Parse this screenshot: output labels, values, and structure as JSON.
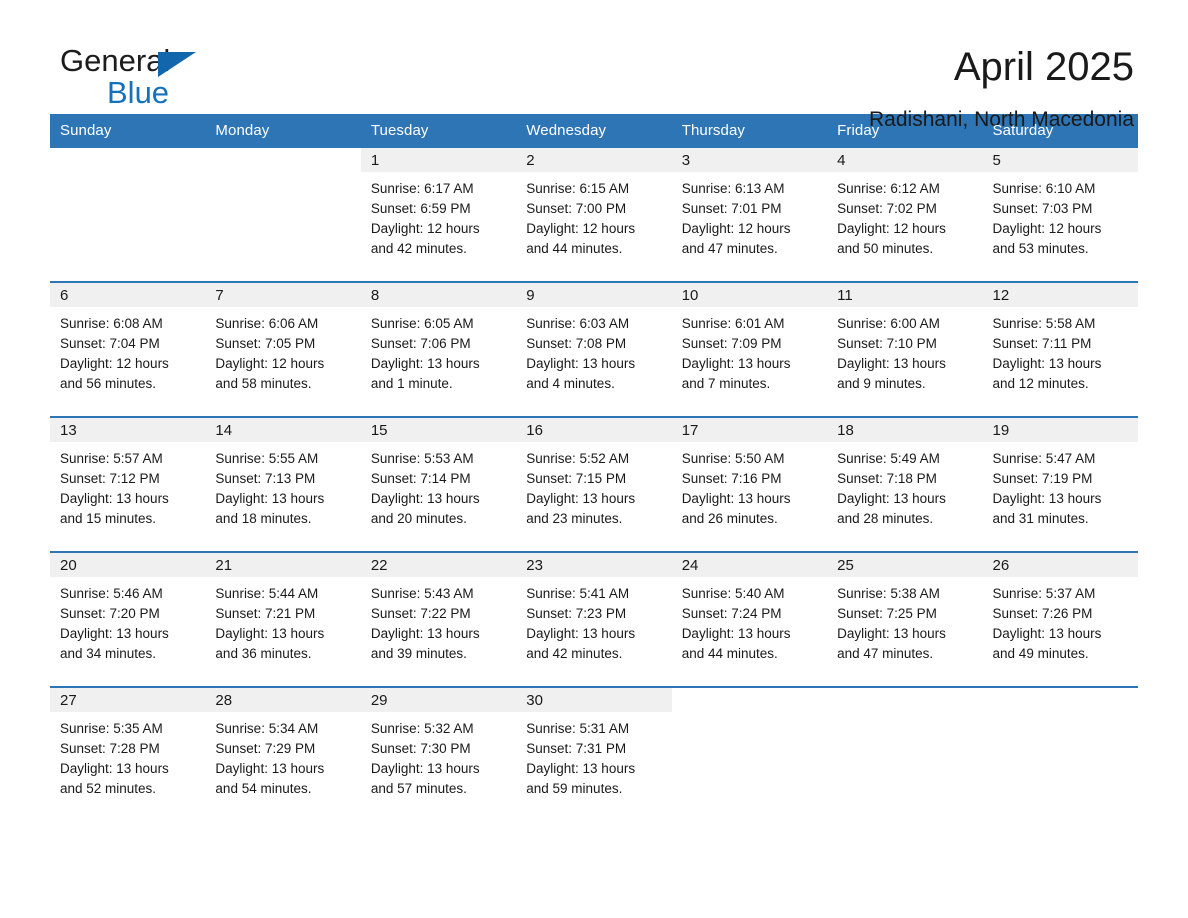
{
  "brand": {
    "name_part1": "General",
    "name_part2": "Blue",
    "triangle_color": "#1266ab",
    "blue_color": "#1372bb"
  },
  "header": {
    "title": "April 2025",
    "subtitle": "Radishani, North Macedonia"
  },
  "theme": {
    "header_blue": "#2e75b6",
    "daynum_band": "#f0f0f0",
    "text": "#1a1a1a"
  },
  "calendar": {
    "weekday_headers": [
      "Sunday",
      "Monday",
      "Tuesday",
      "Wednesday",
      "Thursday",
      "Friday",
      "Saturday"
    ],
    "weeks": [
      [
        {
          "day": "",
          "blank": true
        },
        {
          "day": "",
          "blank": true
        },
        {
          "day": "1",
          "sunrise": "Sunrise: 6:17 AM",
          "sunset": "Sunset: 6:59 PM",
          "daylight1": "Daylight: 12 hours",
          "daylight2": "and 42 minutes."
        },
        {
          "day": "2",
          "sunrise": "Sunrise: 6:15 AM",
          "sunset": "Sunset: 7:00 PM",
          "daylight1": "Daylight: 12 hours",
          "daylight2": "and 44 minutes."
        },
        {
          "day": "3",
          "sunrise": "Sunrise: 6:13 AM",
          "sunset": "Sunset: 7:01 PM",
          "daylight1": "Daylight: 12 hours",
          "daylight2": "and 47 minutes."
        },
        {
          "day": "4",
          "sunrise": "Sunrise: 6:12 AM",
          "sunset": "Sunset: 7:02 PM",
          "daylight1": "Daylight: 12 hours",
          "daylight2": "and 50 minutes."
        },
        {
          "day": "5",
          "sunrise": "Sunrise: 6:10 AM",
          "sunset": "Sunset: 7:03 PM",
          "daylight1": "Daylight: 12 hours",
          "daylight2": "and 53 minutes."
        }
      ],
      [
        {
          "day": "6",
          "sunrise": "Sunrise: 6:08 AM",
          "sunset": "Sunset: 7:04 PM",
          "daylight1": "Daylight: 12 hours",
          "daylight2": "and 56 minutes."
        },
        {
          "day": "7",
          "sunrise": "Sunrise: 6:06 AM",
          "sunset": "Sunset: 7:05 PM",
          "daylight1": "Daylight: 12 hours",
          "daylight2": "and 58 minutes."
        },
        {
          "day": "8",
          "sunrise": "Sunrise: 6:05 AM",
          "sunset": "Sunset: 7:06 PM",
          "daylight1": "Daylight: 13 hours",
          "daylight2": "and 1 minute."
        },
        {
          "day": "9",
          "sunrise": "Sunrise: 6:03 AM",
          "sunset": "Sunset: 7:08 PM",
          "daylight1": "Daylight: 13 hours",
          "daylight2": "and 4 minutes."
        },
        {
          "day": "10",
          "sunrise": "Sunrise: 6:01 AM",
          "sunset": "Sunset: 7:09 PM",
          "daylight1": "Daylight: 13 hours",
          "daylight2": "and 7 minutes."
        },
        {
          "day": "11",
          "sunrise": "Sunrise: 6:00 AM",
          "sunset": "Sunset: 7:10 PM",
          "daylight1": "Daylight: 13 hours",
          "daylight2": "and 9 minutes."
        },
        {
          "day": "12",
          "sunrise": "Sunrise: 5:58 AM",
          "sunset": "Sunset: 7:11 PM",
          "daylight1": "Daylight: 13 hours",
          "daylight2": "and 12 minutes."
        }
      ],
      [
        {
          "day": "13",
          "sunrise": "Sunrise: 5:57 AM",
          "sunset": "Sunset: 7:12 PM",
          "daylight1": "Daylight: 13 hours",
          "daylight2": "and 15 minutes."
        },
        {
          "day": "14",
          "sunrise": "Sunrise: 5:55 AM",
          "sunset": "Sunset: 7:13 PM",
          "daylight1": "Daylight: 13 hours",
          "daylight2": "and 18 minutes."
        },
        {
          "day": "15",
          "sunrise": "Sunrise: 5:53 AM",
          "sunset": "Sunset: 7:14 PM",
          "daylight1": "Daylight: 13 hours",
          "daylight2": "and 20 minutes."
        },
        {
          "day": "16",
          "sunrise": "Sunrise: 5:52 AM",
          "sunset": "Sunset: 7:15 PM",
          "daylight1": "Daylight: 13 hours",
          "daylight2": "and 23 minutes."
        },
        {
          "day": "17",
          "sunrise": "Sunrise: 5:50 AM",
          "sunset": "Sunset: 7:16 PM",
          "daylight1": "Daylight: 13 hours",
          "daylight2": "and 26 minutes."
        },
        {
          "day": "18",
          "sunrise": "Sunrise: 5:49 AM",
          "sunset": "Sunset: 7:18 PM",
          "daylight1": "Daylight: 13 hours",
          "daylight2": "and 28 minutes."
        },
        {
          "day": "19",
          "sunrise": "Sunrise: 5:47 AM",
          "sunset": "Sunset: 7:19 PM",
          "daylight1": "Daylight: 13 hours",
          "daylight2": "and 31 minutes."
        }
      ],
      [
        {
          "day": "20",
          "sunrise": "Sunrise: 5:46 AM",
          "sunset": "Sunset: 7:20 PM",
          "daylight1": "Daylight: 13 hours",
          "daylight2": "and 34 minutes."
        },
        {
          "day": "21",
          "sunrise": "Sunrise: 5:44 AM",
          "sunset": "Sunset: 7:21 PM",
          "daylight1": "Daylight: 13 hours",
          "daylight2": "and 36 minutes."
        },
        {
          "day": "22",
          "sunrise": "Sunrise: 5:43 AM",
          "sunset": "Sunset: 7:22 PM",
          "daylight1": "Daylight: 13 hours",
          "daylight2": "and 39 minutes."
        },
        {
          "day": "23",
          "sunrise": "Sunrise: 5:41 AM",
          "sunset": "Sunset: 7:23 PM",
          "daylight1": "Daylight: 13 hours",
          "daylight2": "and 42 minutes."
        },
        {
          "day": "24",
          "sunrise": "Sunrise: 5:40 AM",
          "sunset": "Sunset: 7:24 PM",
          "daylight1": "Daylight: 13 hours",
          "daylight2": "and 44 minutes."
        },
        {
          "day": "25",
          "sunrise": "Sunrise: 5:38 AM",
          "sunset": "Sunset: 7:25 PM",
          "daylight1": "Daylight: 13 hours",
          "daylight2": "and 47 minutes."
        },
        {
          "day": "26",
          "sunrise": "Sunrise: 5:37 AM",
          "sunset": "Sunset: 7:26 PM",
          "daylight1": "Daylight: 13 hours",
          "daylight2": "and 49 minutes."
        }
      ],
      [
        {
          "day": "27",
          "sunrise": "Sunrise: 5:35 AM",
          "sunset": "Sunset: 7:28 PM",
          "daylight1": "Daylight: 13 hours",
          "daylight2": "and 52 minutes."
        },
        {
          "day": "28",
          "sunrise": "Sunrise: 5:34 AM",
          "sunset": "Sunset: 7:29 PM",
          "daylight1": "Daylight: 13 hours",
          "daylight2": "and 54 minutes."
        },
        {
          "day": "29",
          "sunrise": "Sunrise: 5:32 AM",
          "sunset": "Sunset: 7:30 PM",
          "daylight1": "Daylight: 13 hours",
          "daylight2": "and 57 minutes."
        },
        {
          "day": "30",
          "sunrise": "Sunrise: 5:31 AM",
          "sunset": "Sunset: 7:31 PM",
          "daylight1": "Daylight: 13 hours",
          "daylight2": "and 59 minutes."
        },
        {
          "day": "",
          "blank": true
        },
        {
          "day": "",
          "blank": true
        },
        {
          "day": "",
          "blank": true
        }
      ]
    ]
  }
}
